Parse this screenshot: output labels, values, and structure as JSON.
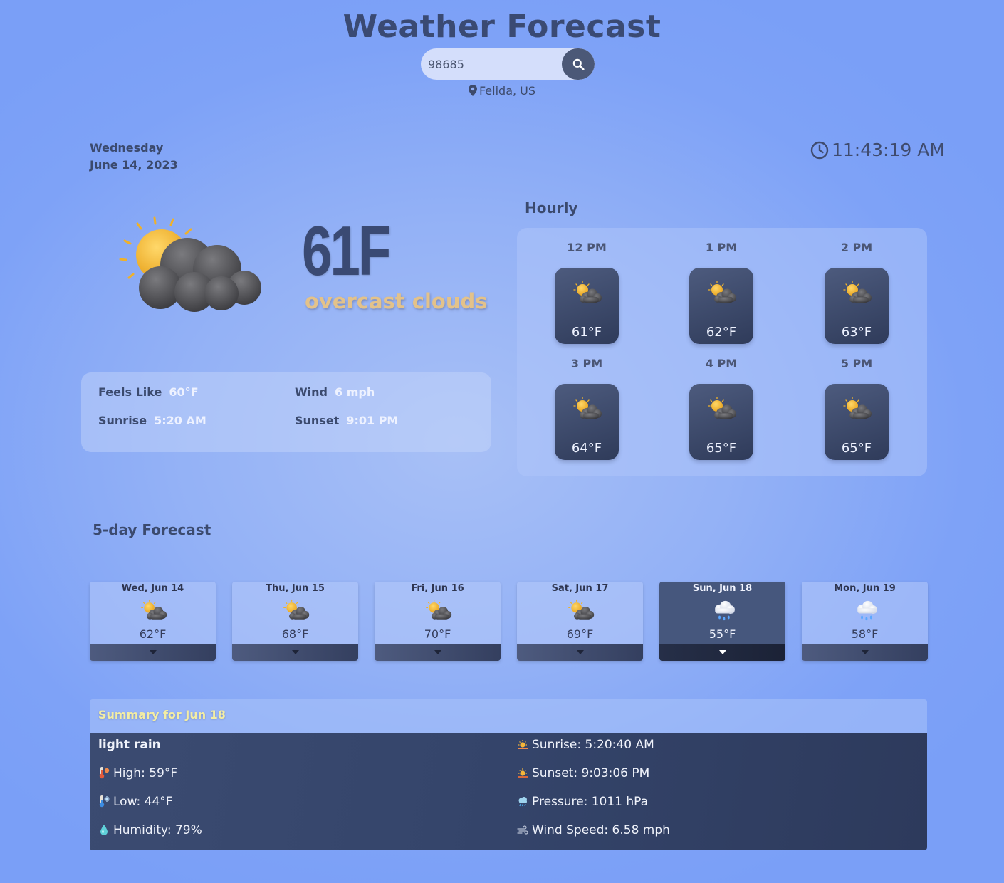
{
  "header": {
    "title": "Weather Forecast",
    "search_value": "98685",
    "location": "Felida, US"
  },
  "current": {
    "day": "Wednesday",
    "date": "June 14, 2023",
    "time": "11:43:19 AM",
    "temp": "61F",
    "description": "overcast clouds",
    "icon": "sun-cloud-icon",
    "details": {
      "feels_like_label": "Feels Like",
      "feels_like_value": "60°F",
      "wind_label": "Wind",
      "wind_value": "6 mph",
      "sunrise_label": "Sunrise",
      "sunrise_value": "5:20 AM",
      "sunset_label": "Sunset",
      "sunset_value": "9:01 PM"
    }
  },
  "hourly": {
    "title": "Hourly",
    "items": [
      {
        "time": "12 PM",
        "temp": "61°F",
        "icon": "sun-cloud-icon"
      },
      {
        "time": "1 PM",
        "temp": "62°F",
        "icon": "sun-cloud-icon"
      },
      {
        "time": "2 PM",
        "temp": "63°F",
        "icon": "sun-cloud-icon"
      },
      {
        "time": "3 PM",
        "temp": "64°F",
        "icon": "sun-cloud-icon"
      },
      {
        "time": "4 PM",
        "temp": "65°F",
        "icon": "sun-cloud-icon"
      },
      {
        "time": "5 PM",
        "temp": "65°F",
        "icon": "sun-cloud-icon"
      }
    ]
  },
  "forecast": {
    "title": "5-day Forecast",
    "days": [
      {
        "name": "Wed, Jun 14",
        "temp": "62°F",
        "icon": "sun-cloud-icon",
        "active": false
      },
      {
        "name": "Thu, Jun 15",
        "temp": "68°F",
        "icon": "sun-cloud-icon",
        "active": false
      },
      {
        "name": "Fri, Jun 16",
        "temp": "70°F",
        "icon": "sun-cloud-icon",
        "active": false
      },
      {
        "name": "Sat, Jun 17",
        "temp": "69°F",
        "icon": "sun-cloud-icon",
        "active": false
      },
      {
        "name": "Sun, Jun 18",
        "temp": "55°F",
        "icon": "rain-cloud-icon",
        "active": true
      },
      {
        "name": "Mon, Jun 19",
        "temp": "58°F",
        "icon": "rain-cloud-icon",
        "active": false
      }
    ]
  },
  "summary": {
    "title": "Summary for Jun 18",
    "condition": "light rain",
    "high": "High: 59°F",
    "low": "Low: 44°F",
    "humidity": "Humidity: 79%",
    "sunrise": "Sunrise: 5:20:40 AM",
    "sunset": "Sunset: 9:03:06 PM",
    "pressure": "Pressure: 1011 hPa",
    "wind_speed": "Wind Speed: 6.58 mph"
  },
  "colors": {
    "background": "#7ea2f7",
    "title": "#3a4a73",
    "description": "#e3c28a",
    "tile": "#3f4c70",
    "summary_title": "#f3eda4"
  }
}
